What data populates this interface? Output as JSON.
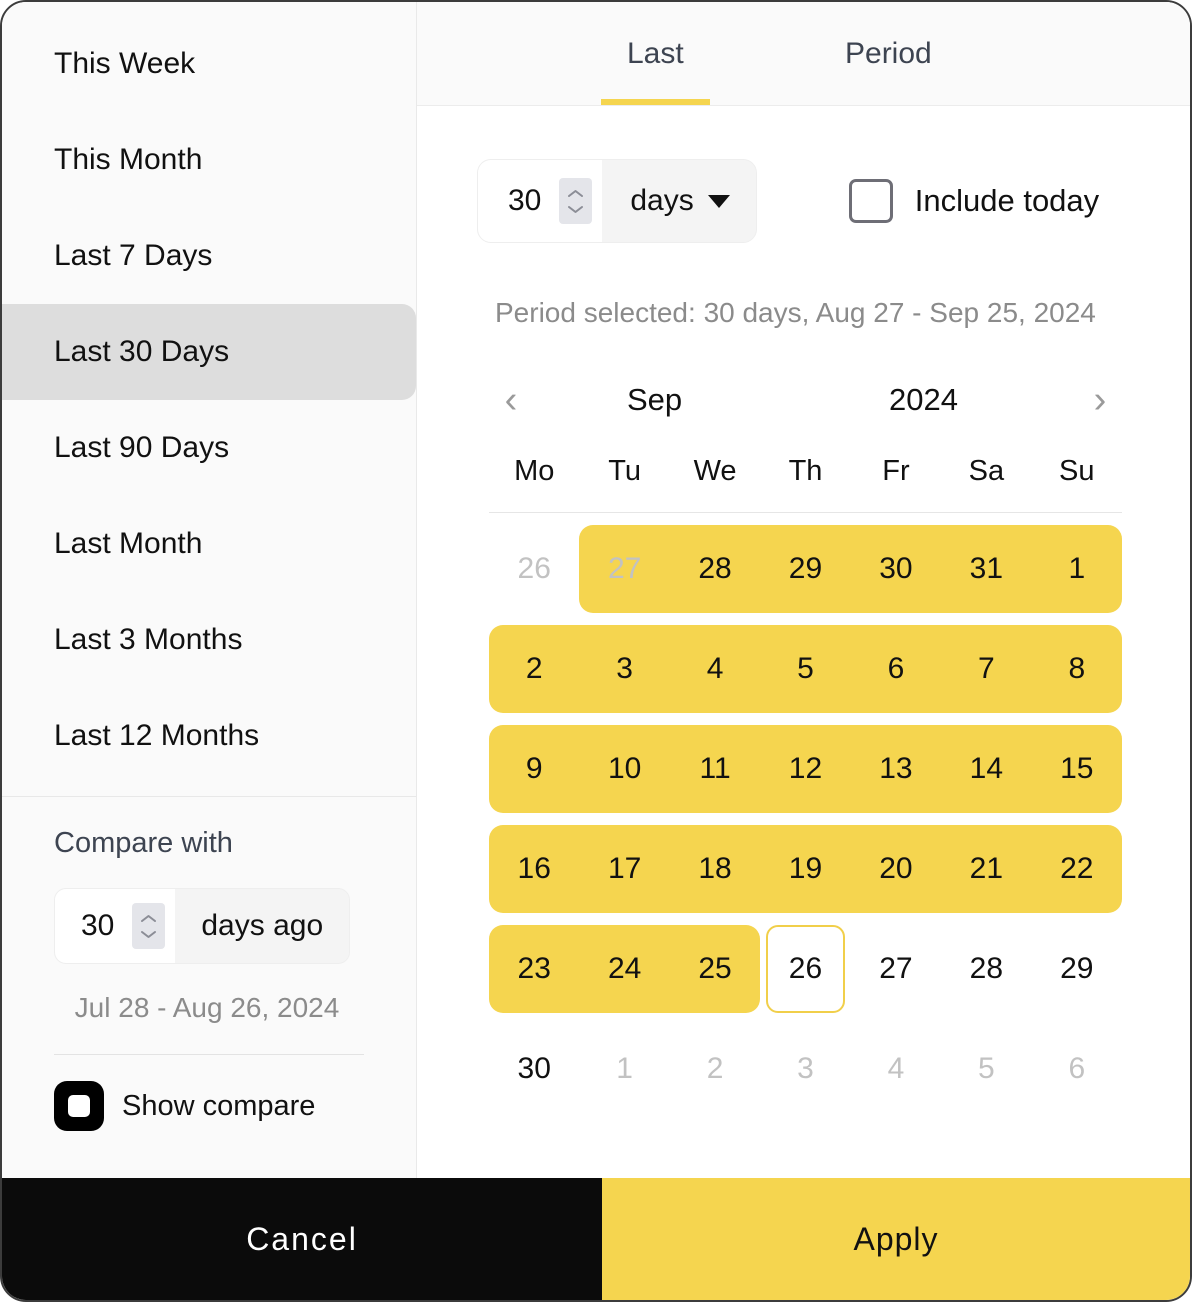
{
  "sidebar": {
    "presets": [
      {
        "label": "This Week",
        "selected": false
      },
      {
        "label": "This Month",
        "selected": false
      },
      {
        "label": "Last 7 Days",
        "selected": false
      },
      {
        "label": "Last 30 Days",
        "selected": true
      },
      {
        "label": "Last 90 Days",
        "selected": false
      },
      {
        "label": "Last Month",
        "selected": false
      },
      {
        "label": "Last 3 Months",
        "selected": false
      },
      {
        "label": "Last 12 Months",
        "selected": false
      }
    ],
    "compare": {
      "title": "Compare with",
      "amount": "30",
      "unit": "days ago",
      "range": "Jul 28 - Aug 26, 2024",
      "show_compare_label": "Show compare",
      "show_compare_on": true
    }
  },
  "main": {
    "tabs": [
      {
        "label": "Last",
        "active": true
      },
      {
        "label": "Period",
        "active": false
      }
    ],
    "last": {
      "amount": "30",
      "unit": "days",
      "include_today_label": "Include today",
      "include_today_checked": false
    },
    "period_selected": "Period selected: 30 days, Aug 27 - Sep 25, 2024",
    "calendar": {
      "prev_icon": "‹",
      "next_icon": "›",
      "month": "Sep",
      "year": "2024",
      "weekdays": [
        "Mo",
        "Tu",
        "We",
        "Th",
        "Fr",
        "Sa",
        "Su"
      ],
      "weeks": [
        [
          {
            "d": "26",
            "muted": true,
            "range": false
          },
          {
            "d": "27",
            "muted": true,
            "range": true,
            "start": true
          },
          {
            "d": "28",
            "muted": false,
            "range": true
          },
          {
            "d": "29",
            "muted": false,
            "range": true
          },
          {
            "d": "30",
            "muted": false,
            "range": true
          },
          {
            "d": "31",
            "muted": false,
            "range": true
          },
          {
            "d": "1",
            "muted": false,
            "range": true,
            "end": true
          }
        ],
        [
          {
            "d": "2",
            "muted": false,
            "range": true,
            "start": true
          },
          {
            "d": "3",
            "muted": false,
            "range": true
          },
          {
            "d": "4",
            "muted": false,
            "range": true
          },
          {
            "d": "5",
            "muted": false,
            "range": true
          },
          {
            "d": "6",
            "muted": false,
            "range": true
          },
          {
            "d": "7",
            "muted": false,
            "range": true
          },
          {
            "d": "8",
            "muted": false,
            "range": true,
            "end": true
          }
        ],
        [
          {
            "d": "9",
            "muted": false,
            "range": true,
            "start": true
          },
          {
            "d": "10",
            "muted": false,
            "range": true
          },
          {
            "d": "11",
            "muted": false,
            "range": true
          },
          {
            "d": "12",
            "muted": false,
            "range": true
          },
          {
            "d": "13",
            "muted": false,
            "range": true
          },
          {
            "d": "14",
            "muted": false,
            "range": true
          },
          {
            "d": "15",
            "muted": false,
            "range": true,
            "end": true
          }
        ],
        [
          {
            "d": "16",
            "muted": false,
            "range": true,
            "start": true
          },
          {
            "d": "17",
            "muted": false,
            "range": true
          },
          {
            "d": "18",
            "muted": false,
            "range": true
          },
          {
            "d": "19",
            "muted": false,
            "range": true
          },
          {
            "d": "20",
            "muted": false,
            "range": true
          },
          {
            "d": "21",
            "muted": false,
            "range": true
          },
          {
            "d": "22",
            "muted": false,
            "range": true,
            "end": true
          }
        ],
        [
          {
            "d": "23",
            "muted": false,
            "range": true,
            "start": true
          },
          {
            "d": "24",
            "muted": false,
            "range": true
          },
          {
            "d": "25",
            "muted": false,
            "range": true,
            "end": true
          },
          {
            "d": "26",
            "muted": false,
            "range": false,
            "today": true
          },
          {
            "d": "27",
            "muted": false,
            "range": false
          },
          {
            "d": "28",
            "muted": false,
            "range": false
          },
          {
            "d": "29",
            "muted": false,
            "range": false
          }
        ],
        [
          {
            "d": "30",
            "muted": false,
            "range": false
          },
          {
            "d": "1",
            "muted": true,
            "range": false
          },
          {
            "d": "2",
            "muted": true,
            "range": false
          },
          {
            "d": "3",
            "muted": true,
            "range": false
          },
          {
            "d": "4",
            "muted": true,
            "range": false
          },
          {
            "d": "5",
            "muted": true,
            "range": false
          },
          {
            "d": "6",
            "muted": true,
            "range": false
          }
        ]
      ]
    }
  },
  "footer": {
    "cancel_label": "Cancel",
    "apply_label": "Apply"
  },
  "colors": {
    "accent_yellow": "#F5D54F",
    "selected_grey": "#DDDDDD",
    "cancel_black": "#0B0B0B",
    "muted_text": "#C2C2C2",
    "secondary_text": "#8B8B8B"
  }
}
